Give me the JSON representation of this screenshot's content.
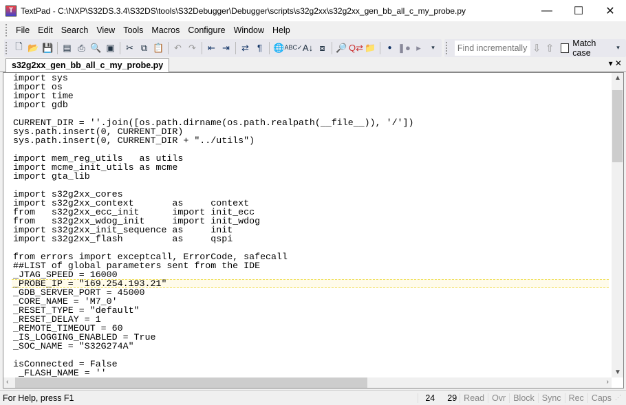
{
  "window": {
    "title": "TextPad - C:\\NXP\\S32DS.3.4\\S32DS\\tools\\S32Debugger\\Debugger\\scripts\\s32g2xx\\s32g2xx_gen_bb_all_c_my_probe.py",
    "minimize": "—",
    "maximize": "☐",
    "close": "✕"
  },
  "menu": [
    "File",
    "Edit",
    "Search",
    "View",
    "Tools",
    "Macros",
    "Configure",
    "Window",
    "Help"
  ],
  "toolbar": {
    "find_placeholder": "Find incrementally",
    "match_case": "Match case",
    "down": "⇩",
    "up": "⇧"
  },
  "tab": {
    "label": "s32g2xx_gen_bb_all_c_my_probe.py",
    "controls": "▾ ✕"
  },
  "code": {
    "current_line": 24,
    "lines": [
      "import sys",
      "import os",
      "import time",
      "import gdb",
      "",
      "CURRENT_DIR = ''.join([os.path.dirname(os.path.realpath(__file__)), '/'])",
      "sys.path.insert(0, CURRENT_DIR)",
      "sys.path.insert(0, CURRENT_DIR + \"../utils\")",
      "",
      "import mem_reg_utils   as utils",
      "import mcme_init_utils as mcme",
      "import gta_lib",
      "",
      "import s32g2xx_cores",
      "import s32g2xx_context       as     context",
      "from   s32g2xx_ecc_init      import init_ecc",
      "from   s32g2xx_wdog_init     import init_wdog",
      "import s32g2xx_init_sequence as     init",
      "import s32g2xx_flash         as     qspi",
      "",
      "from errors import exceptcall, ErrorCode, safecall",
      "##LIST of global parameters sent from the IDE",
      "_JTAG_SPEED = 16000",
      "_PROBE_IP = \"169.254.193.21\"",
      "_GDB_SERVER_PORT = 45000",
      "_CORE_NAME = 'M7_0'",
      "_RESET_TYPE = \"default\"",
      "_RESET_DELAY = 1",
      "_REMOTE_TIMEOUT = 60",
      "_IS_LOGGING_ENABLED = True",
      "_SOC_NAME = \"S32G274A\"",
      "",
      "isConnected = False",
      " _FLASH_NAME = ''"
    ]
  },
  "status": {
    "help": "For Help, press F1",
    "line": "24",
    "column": "29",
    "fields": [
      "Read",
      "Ovr",
      "Block",
      "Sync",
      "Rec",
      "Caps"
    ]
  }
}
